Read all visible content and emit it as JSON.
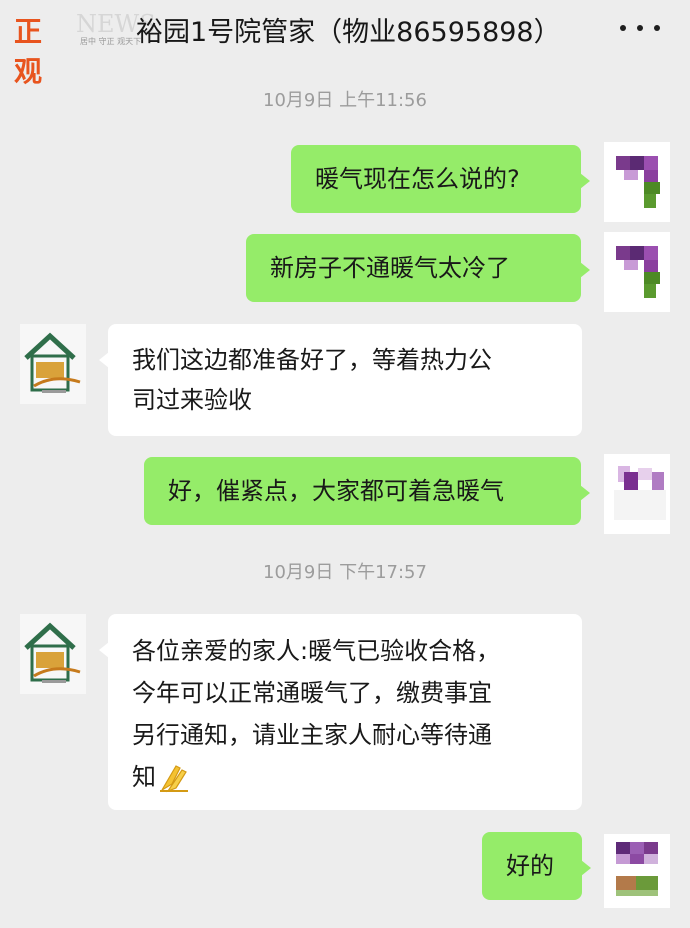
{
  "watermark": {
    "brand_cn": "正观",
    "brand_en": "NEWS",
    "slogan": "居中 守正 观天下"
  },
  "header": {
    "title": "裕园1号院管家（物业86595898）"
  },
  "messages": [
    {
      "type": "time",
      "text": "10月9日 上午11:56"
    },
    {
      "type": "text",
      "side": "right",
      "text": "暖气现在怎么说的?"
    },
    {
      "type": "text",
      "side": "right",
      "text": "新房子不通暖气太冷了"
    },
    {
      "type": "text",
      "side": "left",
      "lines": [
        "我们这边都准备好了，等着热力公",
        "司过来验收"
      ]
    },
    {
      "type": "text",
      "side": "right",
      "text": "好，催紧点，大家都可着急暖气"
    },
    {
      "type": "time",
      "text": "10月9日 下午17:57"
    },
    {
      "type": "text",
      "side": "left",
      "lines": [
        "各位亲爱的家人:暖气已验收合格，",
        "今年可以正常通暖气了，缴费事宜",
        "另行通知，请业主家人耐心等待通",
        "知"
      ],
      "emoji": "pray-hands"
    },
    {
      "type": "text",
      "side": "right",
      "text": "好的"
    }
  ],
  "colors": {
    "background": "#ededed",
    "my_bubble": "#95ec69",
    "their_bubble": "#ffffff",
    "timestamp": "#9c9c9c",
    "watermark_brand": "#e8541e"
  },
  "icons": {
    "more": "more-dots-icon",
    "manager_avatar": "house-logo-icon",
    "user_avatar": "pixelated-avatar-icon",
    "emoji": "pray-hands-emoji"
  }
}
